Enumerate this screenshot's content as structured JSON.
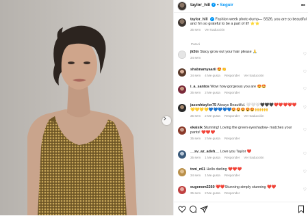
{
  "header": {
    "username": "taylor_hill",
    "separator": "•",
    "follow": "Seguir",
    "verified_icon": "verified-badge-icon"
  },
  "caption": {
    "username": "taylor_hill",
    "text": "Fashion week photo dump— SS26, you are so beautiful and I’m so grateful to be a part of it!! ⭐⭐",
    "time": "35 sem",
    "translate": "Ver traducción"
  },
  "section_label": "Para ti",
  "comments": [
    {
      "username": "jk5tn",
      "text": "Stacy grow out your hair please 🙏",
      "time": "34 sem",
      "likes": "",
      "reply": "",
      "translate": ""
    },
    {
      "username": "shabnamyaarii",
      "text": "😍👏",
      "time": "34 sem",
      "likes": "4 Me gusta",
      "reply": "Responder",
      "translate": "Ver traducción"
    },
    {
      "username": "i_a_santos",
      "text": "Wow how gorgeous you are 😍🤩",
      "time": "35 sem",
      "likes": "2 Me gusta",
      "reply": "Responder",
      "translate": ""
    },
    {
      "username": "jasonhtaylor75",
      "text": "Always Beautiful. 🤍🤍🤍🖤🖤🖤❤️❤️❤️❤️❤️💛💛💛💛💙💙💙💙💙😍😍😍😍😍🙌🙌🙌",
      "time": "35 sem",
      "likes": "2 Me gusta",
      "reply": "Responder",
      "translate": "Ver traducción"
    },
    {
      "username": "ekaisik",
      "text": "Stunning! Loving the green eyeshadow- matches your pants! ❤️❤️❤️",
      "time": "35 sem",
      "likes": "2 Me gusta",
      "reply": "Responder",
      "translate": ""
    },
    {
      "username": "__sv_az_adeh__",
      "text": "Love you Taylor ❤️",
      "time": "35 sem",
      "likes": "1 Me gusta",
      "reply": "Responder",
      "translate": "Ver traducción"
    },
    {
      "username": "toni_n61",
      "text": "Hello darling ❤️❤️❤️",
      "time": "34 sem",
      "likes": "1 Me gusta",
      "reply": "Responder",
      "translate": ""
    },
    {
      "username": "eugenem2260",
      "text": "❤️❤️Stunning simply stunning ❤️❤️",
      "time": "35 sem",
      "likes": "2 Me gusta",
      "reply": "Responder",
      "translate": ""
    }
  ],
  "actions": [
    "heart-icon",
    "comment-icon",
    "share-icon",
    "bookmark-icon"
  ]
}
